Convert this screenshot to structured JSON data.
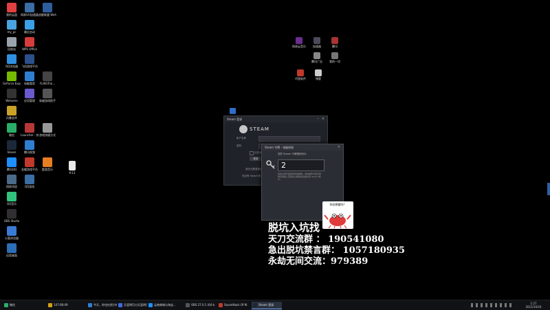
{
  "desktop_left_icons": [
    {
      "label": "我的云盘",
      "color": "#e04040"
    },
    {
      "label": "网易UU加速器",
      "color": "#3a6ea5"
    },
    {
      "label": "战舰联盟 Wehome",
      "color": "#2e5e9e"
    },
    {
      "label": "my_pc",
      "color": "#4aa3df"
    },
    {
      "label": "最近启动",
      "color": "#3aa0e8"
    },
    {
      "label": "回收站",
      "color": "#9aa3ad"
    },
    {
      "label": "WPS Office",
      "color": "#d63c3c"
    },
    {
      "label": "QQ浏览器",
      "color": "#2f8fe0"
    },
    {
      "label": "飞机游戏平台",
      "color": "#2b4f8a"
    },
    {
      "label": "GeForce Experience",
      "color": "#76b900"
    },
    {
      "label": "电脑管家",
      "color": "#2f7fd0"
    },
    {
      "label": "FLiNGTrai...",
      "color": "#444"
    },
    {
      "label": "Wehome",
      "color": "#333"
    },
    {
      "label": "应用管理",
      "color": "#6a5acd"
    },
    {
      "label": "穿越游戏助手",
      "color": "#555"
    },
    {
      "label": "风暴战术",
      "color": "#c9a227"
    },
    {
      "label": "Launcher - 快捷方式",
      "color": "#b73838"
    },
    {
      "label": "游戏快捷方式",
      "color": "#999"
    },
    {
      "label": "微信",
      "color": "#2aae67"
    },
    {
      "label": "腾讯视频",
      "color": "#2f7fd0"
    },
    {
      "label": "Steam",
      "color": "#1b2838"
    },
    {
      "label": "金蝶游戏平台",
      "color": "#c0392b"
    },
    {
      "label": "酷我音乐",
      "color": "#e67e22"
    },
    {
      "label": "腾讯QQ",
      "color": "#1e90ff"
    },
    {
      "label": "QQ游戏",
      "color": "#3a6ea5"
    },
    {
      "label": "网络邻居",
      "color": "#4a6a8a"
    },
    {
      "label": "QQ音乐",
      "color": "#31c27c"
    },
    {
      "label": "OBS Studio",
      "color": "#302e31"
    },
    {
      "label": "火狐浏览器",
      "color": "#3a7bd5"
    },
    {
      "label": "远程桌面",
      "color": "#2c6fb7"
    }
  ],
  "desktop_mid_icon": {
    "label": "K-13",
    "color": "#ddd"
  },
  "desktop_right_icons": [
    {
      "label": "网易云音乐",
      "color": "#6b2d8f"
    },
    {
      "label": "加速器",
      "color": "#4a4a5a"
    },
    {
      "label": "腾讯",
      "color": "#a33"
    },
    {
      "label": "腾讯广告",
      "color": "#888"
    },
    {
      "label": "我的一切",
      "color": "#777"
    },
    {
      "label": "代理软件",
      "color": "#c0392b"
    },
    {
      "label": "博客",
      "color": "#ccc"
    }
  ],
  "steam_login": {
    "title": "Steam 登录",
    "brand": "STEAM",
    "account_label": "帐户名称",
    "password_label": "密码",
    "remember_label": "记住我的密码",
    "login_label": "登录",
    "forgot_label": "我无法登录到我的帐户",
    "create_label": "还没有 Steam 帐户？"
  },
  "steam_guard": {
    "title": "Steam 令牌 - 电脑授权",
    "subtitle": "您的 Steam 令牌授权码为",
    "code_value": "2",
    "description": "您的令牌已发送到您的邮箱。请将邮件中显示的验证码输入至此处以授权本设备访问 Steam 帐户。"
  },
  "overlay": {
    "line1": "脱坑入坑找",
    "line2": "天刀交流群  ：  190541080",
    "line3": "急出脱坑禁言群：  1057180935",
    "line4": "永劫无间交流：979389",
    "sticker_text": "你还想要吗？"
  },
  "taskbar": {
    "start_label": "微信",
    "items": [
      {
        "label": "147:08:49",
        "color": "#d4a017",
        "active": false
      },
      {
        "label": "今天，你也在努力吗?",
        "color": "#2f7fd0",
        "active": false
      },
      {
        "label": "天涯明月刀天涯明月...",
        "color": "#4169e1",
        "active": false
      },
      {
        "label": "云南商城与淘宝...",
        "color": "#1e90ff",
        "active": false
      },
      {
        "label": "OBS 27.0.1 (64 bit)...",
        "color": "#555",
        "active": false
      },
      {
        "label": "SoundHack Of M...",
        "color": "#c0392b",
        "active": false
      },
      {
        "label": "Steam 登录",
        "color": "#1b2838",
        "active": true
      }
    ],
    "clock_time": "1:27",
    "clock_date": "2021/10/24"
  }
}
